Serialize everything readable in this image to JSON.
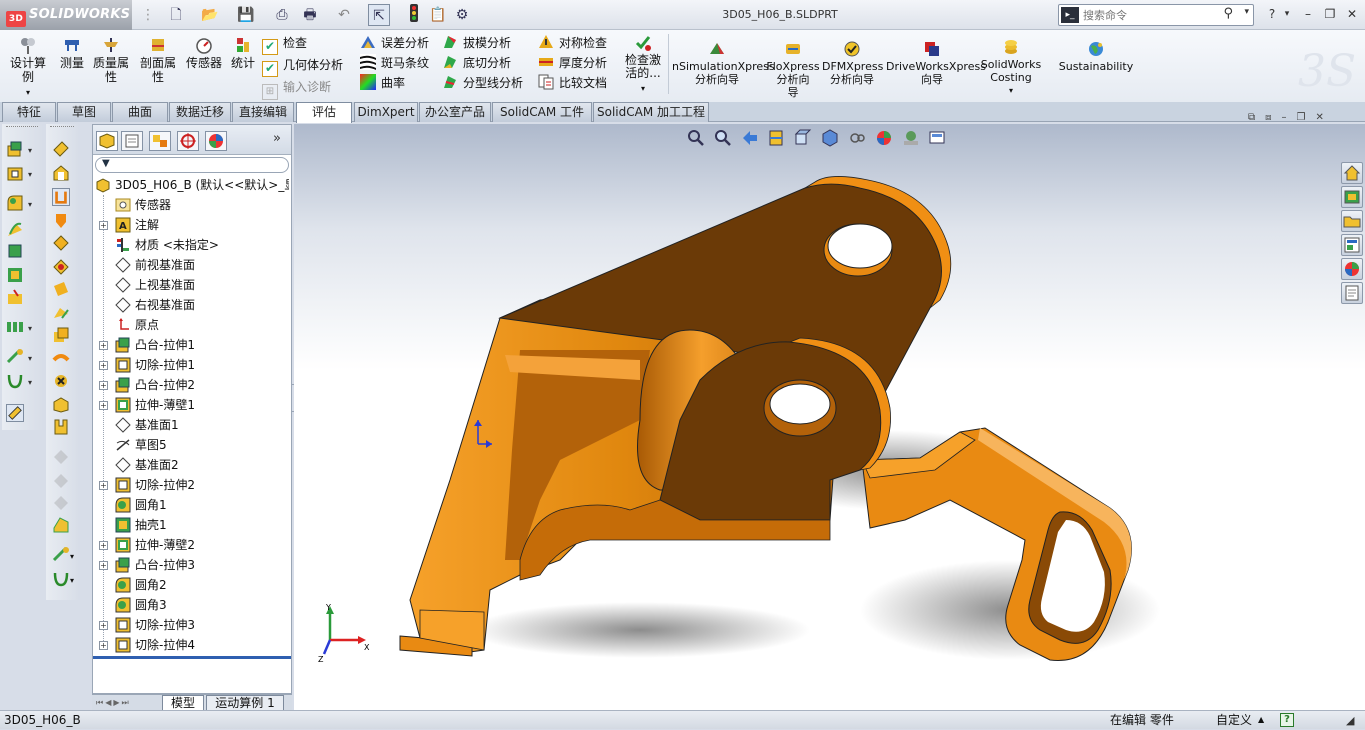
{
  "app": {
    "brand": "SOLIDWORKS",
    "doc_title": "3D05_H06_B.SLDPRT"
  },
  "search": {
    "placeholder": "搜索命令"
  },
  "window_controls": [
    "?",
    "▾",
    "–",
    "❐",
    "✕"
  ],
  "ribbon": {
    "big_tools": [
      {
        "label": "设计算例",
        "icon": "design-study-icon"
      },
      {
        "label": "测量",
        "icon": "measure-icon"
      },
      {
        "label": "质量属性",
        "icon": "mass-properties-icon"
      },
      {
        "label": "剖面属性",
        "icon": "section-properties-icon"
      },
      {
        "label": "传感器",
        "icon": "sensor-icon"
      },
      {
        "label": "统计",
        "icon": "statistics-icon"
      }
    ],
    "check_col": [
      "检查",
      "几何体分析",
      "输入诊断"
    ],
    "analysis_col1": [
      "误差分析",
      "斑马条纹",
      "曲率"
    ],
    "analysis_col2": [
      "拔模分析",
      "底切分析",
      "分型线分析"
    ],
    "analysis_col3": [
      "对称检查",
      "厚度分析",
      "比较文档"
    ],
    "check_active": "检查激活的...",
    "xpress": [
      {
        "label": "nSimulationXpress\n分析向导"
      },
      {
        "label": "FloXpress\n分析向\n导"
      },
      {
        "label": "DFMXpress\n分析向导"
      },
      {
        "label": "DriveWorksXpress\n向导"
      },
      {
        "label": "SolidWorks\nCosting"
      },
      {
        "label": "Sustainability"
      }
    ]
  },
  "tabs": [
    "特征",
    "草图",
    "曲面",
    "数据迁移",
    "直接编辑",
    "评估",
    "DimXpert",
    "办公室产品",
    "SolidCAM 工件",
    "SolidCAM 加工工程"
  ],
  "active_tab": "评估",
  "tree": {
    "root": "3D05_H06_B  (默认<<默认>_显",
    "items": [
      {
        "label": "传感器",
        "icon": "sensor-folder-icon",
        "expand": false
      },
      {
        "label": "注解",
        "icon": "annotations-icon",
        "expand": true
      },
      {
        "label": "材质 <未指定>",
        "icon": "material-icon",
        "expand": false
      },
      {
        "label": "前视基准面",
        "icon": "plane-icon",
        "expand": false
      },
      {
        "label": "上视基准面",
        "icon": "plane-icon",
        "expand": false
      },
      {
        "label": "右视基准面",
        "icon": "plane-icon",
        "expand": false
      },
      {
        "label": "原点",
        "icon": "origin-icon",
        "expand": false
      },
      {
        "label": "凸台-拉伸1",
        "icon": "boss-extrude-icon",
        "expand": true
      },
      {
        "label": "切除-拉伸1",
        "icon": "cut-extrude-icon",
        "expand": true
      },
      {
        "label": "凸台-拉伸2",
        "icon": "boss-extrude-icon",
        "expand": true
      },
      {
        "label": "拉伸-薄壁1",
        "icon": "thin-extrude-icon",
        "expand": true
      },
      {
        "label": "基准面1",
        "icon": "plane-icon",
        "expand": false
      },
      {
        "label": "草图5",
        "icon": "sketch-icon",
        "expand": false
      },
      {
        "label": "基准面2",
        "icon": "plane-icon",
        "expand": false
      },
      {
        "label": "切除-拉伸2",
        "icon": "cut-extrude-icon",
        "expand": true
      },
      {
        "label": "圆角1",
        "icon": "fillet-icon",
        "expand": false
      },
      {
        "label": "抽壳1",
        "icon": "shell-icon",
        "expand": false
      },
      {
        "label": "拉伸-薄壁2",
        "icon": "thin-extrude-icon",
        "expand": true
      },
      {
        "label": "凸台-拉伸3",
        "icon": "boss-extrude-icon",
        "expand": true
      },
      {
        "label": "圆角2",
        "icon": "fillet-icon",
        "expand": false
      },
      {
        "label": "圆角3",
        "icon": "fillet-icon",
        "expand": false
      },
      {
        "label": "切除-拉伸3",
        "icon": "cut-extrude-icon",
        "expand": true
      },
      {
        "label": "切除-拉伸4",
        "icon": "cut-extrude-icon",
        "expand": true
      }
    ]
  },
  "model_tabs": [
    "模型",
    "运动算例 1"
  ],
  "status": {
    "left": "3D05_H06_B",
    "editing": "在编辑 零件",
    "units": "自定义",
    "units_arrow": "▲"
  },
  "axes": {
    "x": "X",
    "y": "Y",
    "z": "Z"
  },
  "colors": {
    "part": "#e98a12",
    "part_dark": "#6b3a07",
    "part_shadow": "#a85a05"
  }
}
